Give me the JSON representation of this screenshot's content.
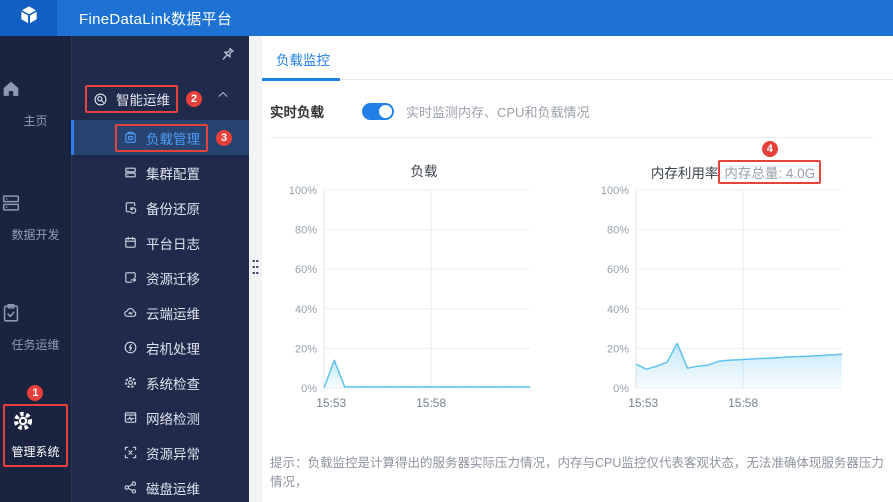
{
  "header": {
    "title": "FineDataLink数据平台"
  },
  "rail": {
    "items": [
      {
        "label": "主页"
      },
      {
        "label": "数据开发"
      },
      {
        "label": "任务运维"
      },
      {
        "label": "管理系统"
      }
    ]
  },
  "submenu": {
    "group": {
      "label": "智能运维"
    },
    "items": [
      {
        "label": "负载管理"
      },
      {
        "label": "集群配置"
      },
      {
        "label": "备份还原"
      },
      {
        "label": "平台日志"
      },
      {
        "label": "资源迁移"
      },
      {
        "label": "云端运维"
      },
      {
        "label": "宕机处理"
      },
      {
        "label": "系统检查"
      },
      {
        "label": "网络检测"
      },
      {
        "label": "资源异常"
      },
      {
        "label": "磁盘运维"
      }
    ]
  },
  "main": {
    "tab": "负载监控",
    "realtime_label": "实时负载",
    "toggle_state": "on",
    "realtime_desc": "实时监测内存、CPU和负载情况",
    "tip": "提示：负载监控是计算得出的服务器实际压力情况，内存与CPU监控仅代表客观状态，无法准确体现服务器压力情况，"
  },
  "annotations": {
    "badges": [
      "1",
      "2",
      "3",
      "4"
    ]
  },
  "colors": {
    "header_blue": "#1d72d3",
    "logo_blue": "#115fc2",
    "sidebar_dark": "#1a2340",
    "submenu_dark": "#202b4b",
    "selected_row": "#27436f",
    "accent_blue": "#2080e8",
    "annotation_red": "#e8403a",
    "chart_line": "#5fc3ef"
  },
  "chart_data": [
    {
      "type": "line",
      "title": "负载",
      "x_ticks": [
        "15:53",
        "15:58"
      ],
      "x_tick_fractions": [
        0.035,
        0.52
      ],
      "y_ticks": [
        "0%",
        "20%",
        "40%",
        "60%",
        "80%",
        "100%"
      ],
      "ylim": [
        0,
        100
      ],
      "grid": true,
      "legend": "none",
      "line_color": "#5fc3ef",
      "values": [
        0,
        14,
        0.6,
        0.5,
        0.6,
        0.5,
        0.6,
        0.5,
        0.6,
        0.5,
        0.6,
        0.5,
        0.6,
        0.5,
        0.6,
        0.5,
        0.6,
        0.5,
        0.6,
        0.5,
        0.6
      ]
    },
    {
      "type": "line",
      "title": "内存利用率",
      "subtitle": "内存总量: 4.0G",
      "x_ticks": [
        "15:53",
        "15:58"
      ],
      "x_tick_fractions": [
        0.035,
        0.52
      ],
      "y_ticks": [
        "0%",
        "20%",
        "40%",
        "60%",
        "80%",
        "100%"
      ],
      "ylim": [
        0,
        100
      ],
      "grid": true,
      "legend": "none",
      "line_color": "#5fc3ef",
      "values": [
        12,
        9.5,
        11,
        13,
        22.5,
        10,
        11,
        11.5,
        13.5,
        14,
        14.3,
        14.6,
        14.9,
        15.1,
        15.4,
        15.7,
        15.9,
        16.1,
        16.4,
        16.7,
        17
      ]
    }
  ]
}
